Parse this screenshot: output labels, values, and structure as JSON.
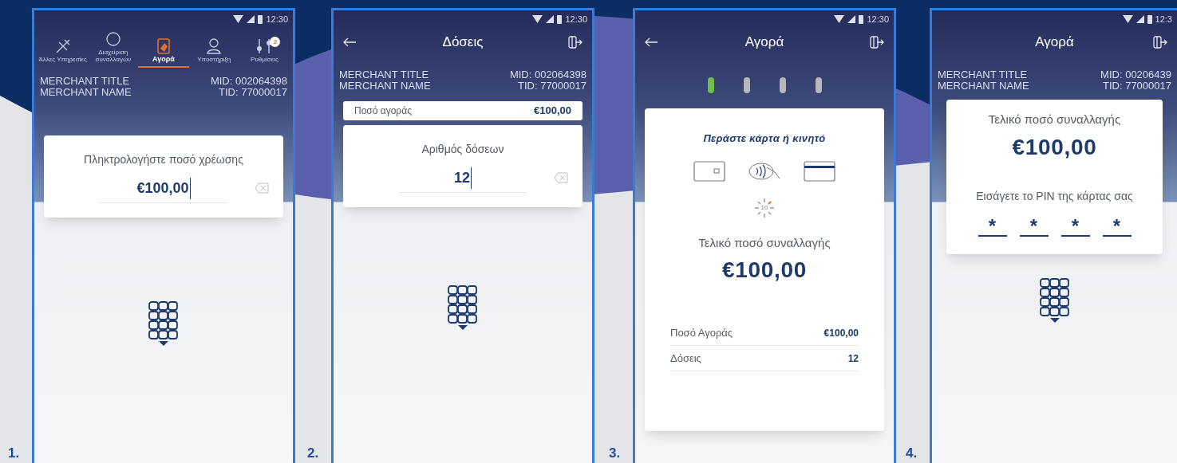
{
  "screens": [
    {
      "step": "1.",
      "kind": "amount",
      "status_time": "12:30",
      "header": {
        "kind": "tabs",
        "tabs": [
          {
            "label": "Άλλες Υπηρεσίες",
            "selected": false
          },
          {
            "label": "Διαχείριση συναλλαγών",
            "selected": false
          },
          {
            "label": "Αγορά",
            "selected": true
          },
          {
            "label": "Υποστήριξη",
            "selected": false
          },
          {
            "label": "Ρυθμίσεις",
            "selected": false,
            "badge": "2"
          }
        ]
      },
      "merchant": {
        "title": "MERCHANT TITLE",
        "name": "MERCHANT NAME",
        "mid": "MID: 002064398",
        "tid": "TID: 77000017"
      },
      "card": {
        "prompt": "Πληκτρολογήστε ποσό χρέωσης",
        "value": "€100,00"
      },
      "keypad": true
    },
    {
      "step": "2.",
      "kind": "installments",
      "status_time": "12:30",
      "header": {
        "kind": "title",
        "title": "Δόσεις",
        "back": true,
        "exit": true
      },
      "merchant": {
        "title": "MERCHANT TITLE",
        "name": "MERCHANT NAME",
        "mid": "MID: 002064398",
        "tid": "TID: 77000017"
      },
      "summary": {
        "label": "Ποσό αγοράς",
        "value": "€100,00"
      },
      "card": {
        "prompt": "Αριθμός δόσεων",
        "value": "12"
      },
      "keypad": true
    },
    {
      "step": "3.",
      "kind": "card",
      "status_time": "12:30",
      "header": {
        "kind": "title",
        "title": "Αγορά",
        "back": true,
        "exit": true
      },
      "progress": [
        {
          "done": true
        },
        {
          "done": false
        },
        {
          "done": false
        },
        {
          "done": false
        }
      ],
      "card": {
        "heading": "Περάστε κάρτα ή κινητό",
        "timer": "10",
        "total_label": "Τελικό ποσό συναλλαγής",
        "amount": "€100,00",
        "rows": [
          {
            "label": "Ποσό Αγοράς",
            "value": "€100,00"
          },
          {
            "label": "Δόσεις",
            "value": "12"
          }
        ]
      },
      "keypad": false
    },
    {
      "step": "4.",
      "kind": "pin",
      "status_time": "12:3",
      "header": {
        "kind": "title",
        "title": "Αγορά",
        "back": false,
        "exit": true
      },
      "merchant": {
        "title": "MERCHANT TITLE",
        "name": "MERCHANT NAME",
        "mid": "MID: 00206439",
        "tid": "TID: 77000017"
      },
      "card": {
        "total_label": "Τελικό ποσό συναλλαγής",
        "amount": "€100,00",
        "pin_label": "Εισάγετε το PIN της κάρτας σας",
        "pin": [
          "*",
          "*",
          "*",
          "*"
        ]
      },
      "keypad": true
    }
  ]
}
